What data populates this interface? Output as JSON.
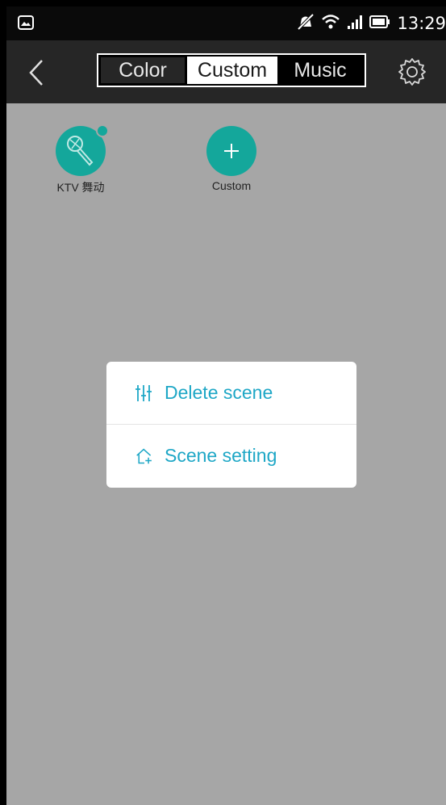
{
  "status_bar": {
    "time": "13:29",
    "icons": [
      "gallery-icon",
      "mute-icon",
      "wifi-icon",
      "signal-icon",
      "battery-icon"
    ]
  },
  "header": {
    "tabs": [
      {
        "label": "Color",
        "selected": false
      },
      {
        "label": "Custom",
        "selected": true
      },
      {
        "label": "Music",
        "selected": false
      }
    ],
    "icons": [
      "back-icon",
      "gear-icon"
    ]
  },
  "scenes": [
    {
      "label": "KTV 舞动",
      "icon": "microphone-icon"
    },
    {
      "label": "Custom",
      "icon": "plus-icon"
    }
  ],
  "popup_menu": {
    "items": [
      {
        "label": "Delete scene",
        "icon": "sliders-icon"
      },
      {
        "label": "Scene setting",
        "icon": "home-plus-icon"
      }
    ]
  },
  "colors": {
    "accent": "#14a79b",
    "menu_text": "#1ea7c6",
    "overlay_bg": "#a6a6a6",
    "header_bg": "#262626"
  }
}
